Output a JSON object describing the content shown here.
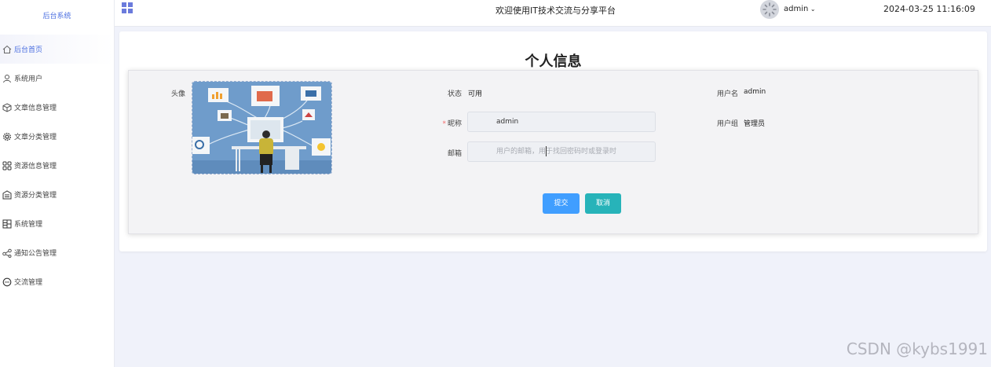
{
  "sidebar": {
    "brand": "后台系统",
    "items": [
      {
        "label": "后台首页",
        "icon": "home-icon",
        "active": true
      },
      {
        "label": "系统用户",
        "icon": "user-icon"
      },
      {
        "label": "文章信息管理",
        "icon": "cube-icon"
      },
      {
        "label": "文章分类管理",
        "icon": "gear-icon"
      },
      {
        "label": "资源信息管理",
        "icon": "grid-icon"
      },
      {
        "label": "资源分类管理",
        "icon": "building-icon"
      },
      {
        "label": "系统管理",
        "icon": "apps-icon"
      },
      {
        "label": "通知公告管理",
        "icon": "share-icon"
      },
      {
        "label": "交流管理",
        "icon": "chat-icon"
      }
    ]
  },
  "header": {
    "welcome": "欢迎使用IT技术交流与分享平台",
    "user": "admin",
    "datetime": "2024-03-25 11:16:09"
  },
  "page": {
    "title": "个人信息"
  },
  "form": {
    "avatar_label": "头像",
    "status_label": "状态",
    "status_value": "可用",
    "username_label": "用户名",
    "username_value": "admin",
    "nickname_label": "昵称",
    "nickname_value": "admin",
    "usergroup_label": "用户组",
    "usergroup_value": "管理员",
    "email_label": "邮箱",
    "email_placeholder": "用户的邮箱，用于找回密码时或登录时",
    "submit": "提交",
    "cancel": "取消"
  },
  "watermark": "CSDN @kybs1991",
  "colors": {
    "accent": "#409eff",
    "cancel": "#27b3b9",
    "required": "#f56c6c"
  }
}
